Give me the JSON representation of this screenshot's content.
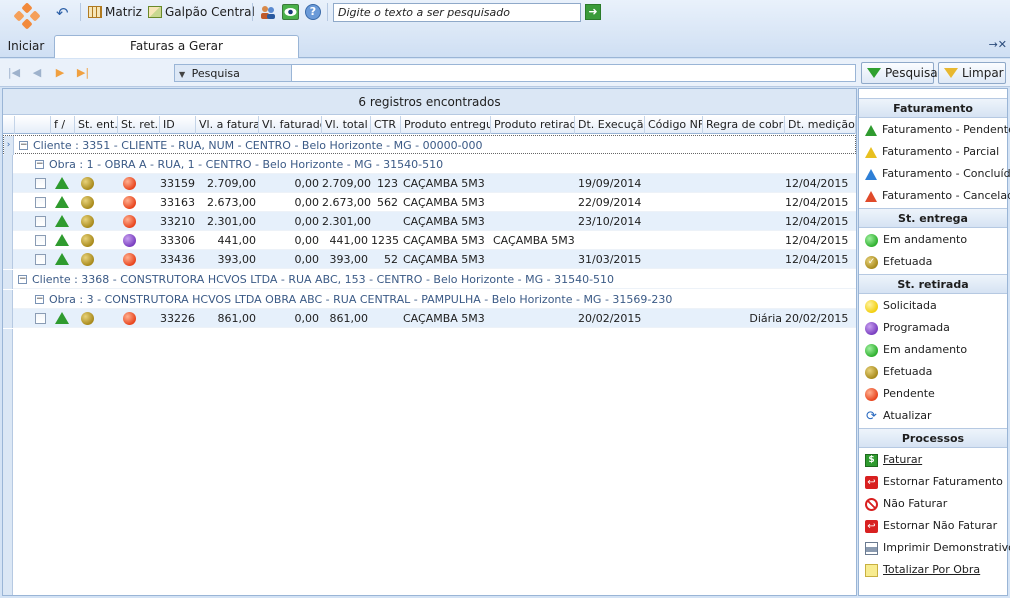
{
  "toolbar": {
    "start_label": "Iniciar",
    "matriz_label": "Matriz",
    "galpao_label": "Galpão Central",
    "search_placeholder": "Digite o texto a ser pesquisado"
  },
  "tabs": [
    {
      "label": "Faturas a Gerar"
    }
  ],
  "filter": {
    "pesquisa_label": "Pesquisa",
    "pesquisar_button": "Pesquisar",
    "limpar_button": "Limpar"
  },
  "grid": {
    "record_count": "6 registros encontrados",
    "columns": [
      "f /",
      "St. ent.",
      "St. ret.",
      "ID",
      "Vl. a faturar",
      "Vl. faturado",
      "Vl. total",
      "CTR",
      "Produto entregue",
      "Produto retirado",
      "Dt. Execução",
      "Código NF",
      "Regra de cobrar",
      "Dt. medição"
    ],
    "groups": [
      {
        "cliente": "Cliente : 3351 - CLIENTE - RUA, NUM - CENTRO - Belo Horizonte - MG - 00000-000",
        "obra": "Obra : 1 - OBRA A - RUA, 1 - CENTRO - Belo Horizonte - MG - 31540-510",
        "rows": [
          {
            "st_ret": "red",
            "id": "33159",
            "vl_fat": "2.709,00",
            "vl_faturado": "0,00",
            "vl_total": "2.709,00",
            "ctr": "123",
            "prod_ent": "CAÇAMBA 5M3",
            "prod_ret": "",
            "dt_exec": "19/09/2014",
            "cod_nf": "",
            "regra": "",
            "dt_med": "12/04/2015"
          },
          {
            "st_ret": "red",
            "id": "33163",
            "vl_fat": "2.673,00",
            "vl_faturado": "0,00",
            "vl_total": "2.673,00",
            "ctr": "562",
            "prod_ent": "CAÇAMBA 5M3",
            "prod_ret": "",
            "dt_exec": "22/09/2014",
            "cod_nf": "",
            "regra": "",
            "dt_med": "12/04/2015"
          },
          {
            "st_ret": "red",
            "id": "33210",
            "vl_fat": "2.301,00",
            "vl_faturado": "0,00",
            "vl_total": "2.301,00",
            "ctr": "",
            "prod_ent": "CAÇAMBA 5M3",
            "prod_ret": "",
            "dt_exec": "23/10/2014",
            "cod_nf": "",
            "regra": "",
            "dt_med": "12/04/2015"
          },
          {
            "st_ret": "purple",
            "id": "33306",
            "vl_fat": "441,00",
            "vl_faturado": "0,00",
            "vl_total": "441,00",
            "ctr": "1235",
            "prod_ent": "CAÇAMBA 5M3",
            "prod_ret": "CAÇAMBA 5M3",
            "dt_exec": "",
            "cod_nf": "",
            "regra": "",
            "dt_med": "12/04/2015"
          },
          {
            "st_ret": "red",
            "id": "33436",
            "vl_fat": "393,00",
            "vl_faturado": "0,00",
            "vl_total": "393,00",
            "ctr": "52",
            "prod_ent": "CAÇAMBA 5M3",
            "prod_ret": "",
            "dt_exec": "31/03/2015",
            "cod_nf": "",
            "regra": "",
            "dt_med": "12/04/2015"
          }
        ]
      },
      {
        "cliente": "Cliente : 3368 - CONSTRUTORA HCVOS LTDA - RUA ABC, 153 - CENTRO - Belo Horizonte - MG - 31540-510",
        "obra": "Obra : 3 - CONSTRUTORA HCVOS LTDA OBRA ABC - RUA CENTRAL - PAMPULHA - Belo Horizonte - MG - 31569-230",
        "rows": [
          {
            "st_ret": "red",
            "id": "33226",
            "vl_fat": "861,00",
            "vl_faturado": "0,00",
            "vl_total": "861,00",
            "ctr": "",
            "prod_ent": "CAÇAMBA 5M3",
            "prod_ret": "",
            "dt_exec": "20/02/2015",
            "cod_nf": "",
            "regra": "Diária",
            "dt_med": "20/02/2015"
          }
        ]
      }
    ]
  },
  "panel": {
    "faturamento_title": "Faturamento",
    "faturamento_items": [
      "Faturamento - Pendente",
      "Faturamento - Parcial",
      "Faturamento - Concluído",
      "Faturamento - Cancelado"
    ],
    "st_entrega_title": "St. entrega",
    "st_entrega_items": [
      "Em andamento",
      "Efetuada"
    ],
    "st_retirada_title": "St. retirada",
    "st_retirada_items": [
      "Solicitada",
      "Programada",
      "Em andamento",
      "Efetuada",
      "Pendente",
      "Atualizar"
    ],
    "processos_title": "Processos",
    "processos_items": [
      "Faturar",
      "Estornar Faturamento",
      "Não Faturar",
      "Estornar Não Faturar",
      "Imprimir Demonstrativo",
      "Totalizar Por Obra"
    ]
  },
  "colors": {
    "green_triangle": "#2f9b2f",
    "yellow_triangle": "#e8c020",
    "blue_triangle": "#2e7fd6",
    "red_triangle": "#e04a2a",
    "status_olive": "#a88a1c",
    "status_red": "#e8451e",
    "status_purple": "#7a3fc0",
    "status_green": "#2fb02f",
    "status_yellow": "#f2cf10"
  }
}
